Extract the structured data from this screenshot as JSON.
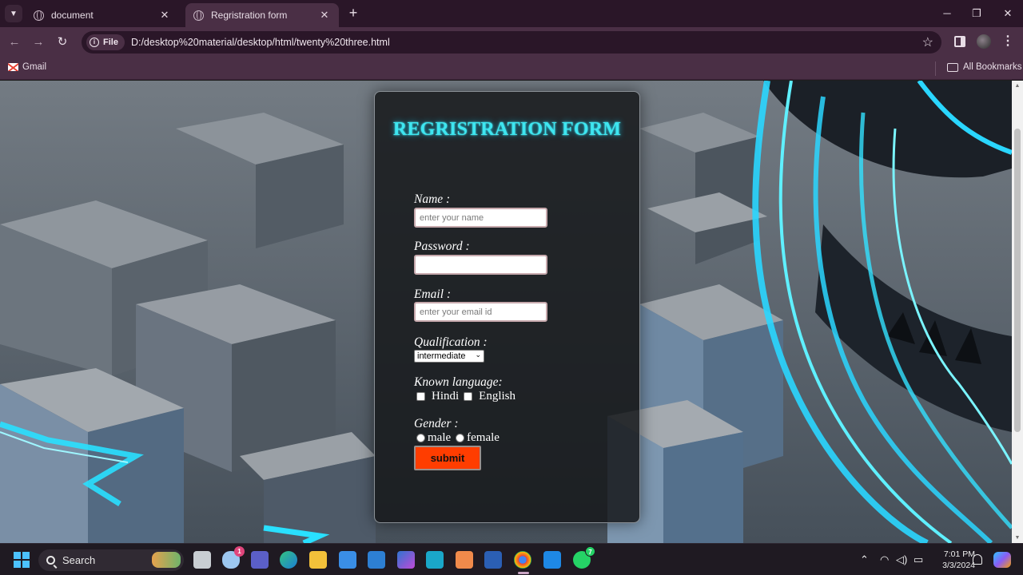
{
  "browser": {
    "tabs": [
      {
        "title": "document",
        "close": "✕"
      },
      {
        "title": "Regristration form",
        "close": "✕"
      }
    ],
    "new_tab": "+",
    "window_controls": {
      "minimize": "─",
      "maximize": "❐",
      "close": "✕"
    },
    "nav": {
      "back": "←",
      "forward": "→",
      "reload": "↻"
    },
    "address": {
      "chip": "File",
      "url": "D:/desktop%20material/desktop/html/twenty%20three.html"
    },
    "bookmarks": {
      "gmail": "Gmail",
      "all": "All Bookmarks"
    }
  },
  "form": {
    "title": "REGRISTRATION FORM",
    "name_label": "Name :",
    "name_placeholder": "enter your name",
    "password_label": "Password :",
    "email_label": "Email :",
    "email_placeholder": "enter your email id",
    "qualification_label": "Qualification :",
    "qualification_value": "intermediate",
    "language_label": "Known language:",
    "languages": [
      "Hindi",
      "English"
    ],
    "gender_label": "Gender :",
    "genders": [
      "male",
      "female"
    ],
    "submit_label": "submit"
  },
  "taskbar": {
    "search_label": "Search",
    "badges": {
      "onedrive": "1",
      "whatsapp": "7"
    },
    "time": "7:01 PM",
    "date": "3/3/2024"
  },
  "colors": {
    "title_cyan": "#3ee6f0",
    "submit_bg": "#ff3d00",
    "browser_frame": "#4a2f45"
  }
}
